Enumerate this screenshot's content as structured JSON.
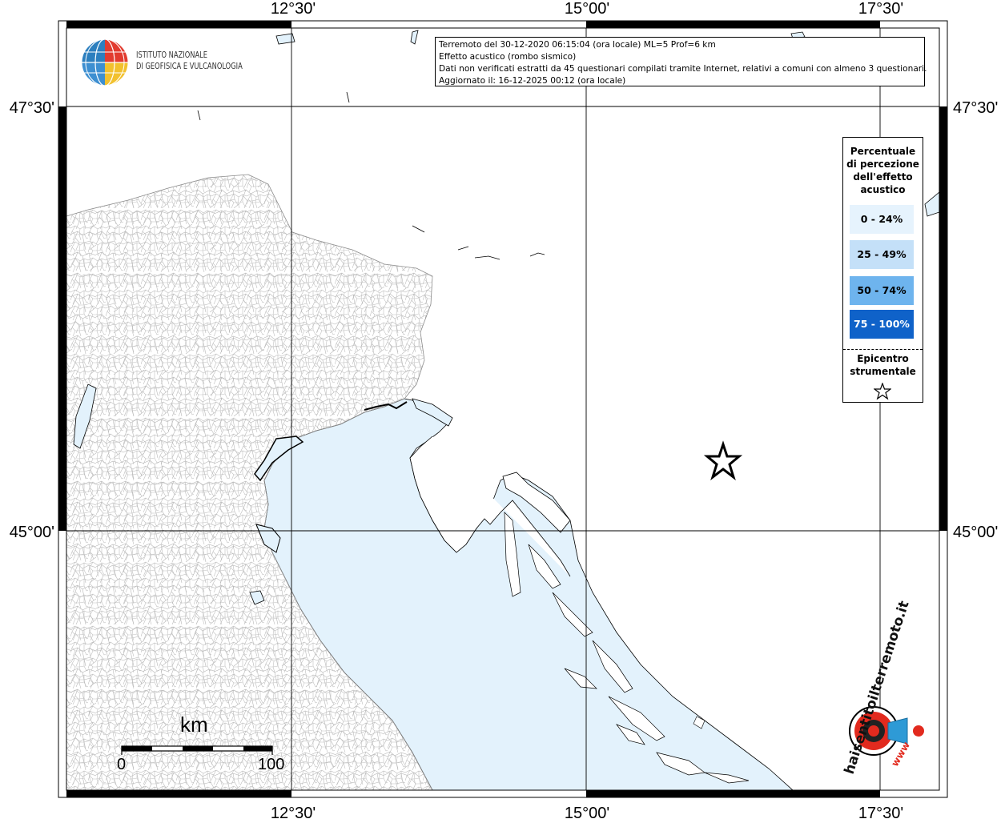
{
  "map": {
    "lon_top_labels": [
      "12°30'",
      "15°00'",
      "17°30'"
    ],
    "lon_bottom_labels": [
      "12°30'",
      "15°00'",
      "17°30'"
    ],
    "lat_left_labels": [
      "47°30'",
      "45°00'"
    ],
    "lat_right_labels": [
      "47°30'",
      "45°00'"
    ],
    "sea_color": "#e3f2fc",
    "land_color": "#ffffff",
    "municipal_border_color": "#b9b9b9"
  },
  "info": {
    "line1": "Terremoto del 30-12-2020 06:15:04 (ora locale) ML=5 Prof=6 km",
    "line2": "Effetto acustico (rombo sismico)",
    "line3": "Dati non verificati estratti da 45 questionari compilati tramite Internet, relativi a comuni con almeno 3 questionari.",
    "line4": "Aggiornato il: 16-12-2025 00:12 (ora locale)"
  },
  "logo_ingv": {
    "line1": "ISTITUTO NAZIONALE",
    "line2": "DI GEOFISICA E VULCANOLOGIA"
  },
  "legend": {
    "title_lines": [
      "Percentuale",
      "di percezione",
      "dell'effetto",
      "acustico"
    ],
    "classes": [
      {
        "label": "0 - 24%",
        "color": "#e6f3fd",
        "text_color": "#000000"
      },
      {
        "label": "25 - 49%",
        "color": "#c4e0f8",
        "text_color": "#000000"
      },
      {
        "label": "50 - 74%",
        "color": "#6eb4ee",
        "text_color": "#000000"
      },
      {
        "label": "75 - 100%",
        "color": "#0f62c9",
        "text_color": "#ffffff"
      }
    ],
    "epicenter_lines": [
      "Epicentro",
      "strumentale"
    ],
    "epicenter_icon": "star-outline-icon"
  },
  "scale_bar": {
    "unit": "km",
    "start": "0",
    "end": "100"
  },
  "logo_hsit": {
    "text": "haisentitoilterremoto.it",
    "www": "www"
  }
}
